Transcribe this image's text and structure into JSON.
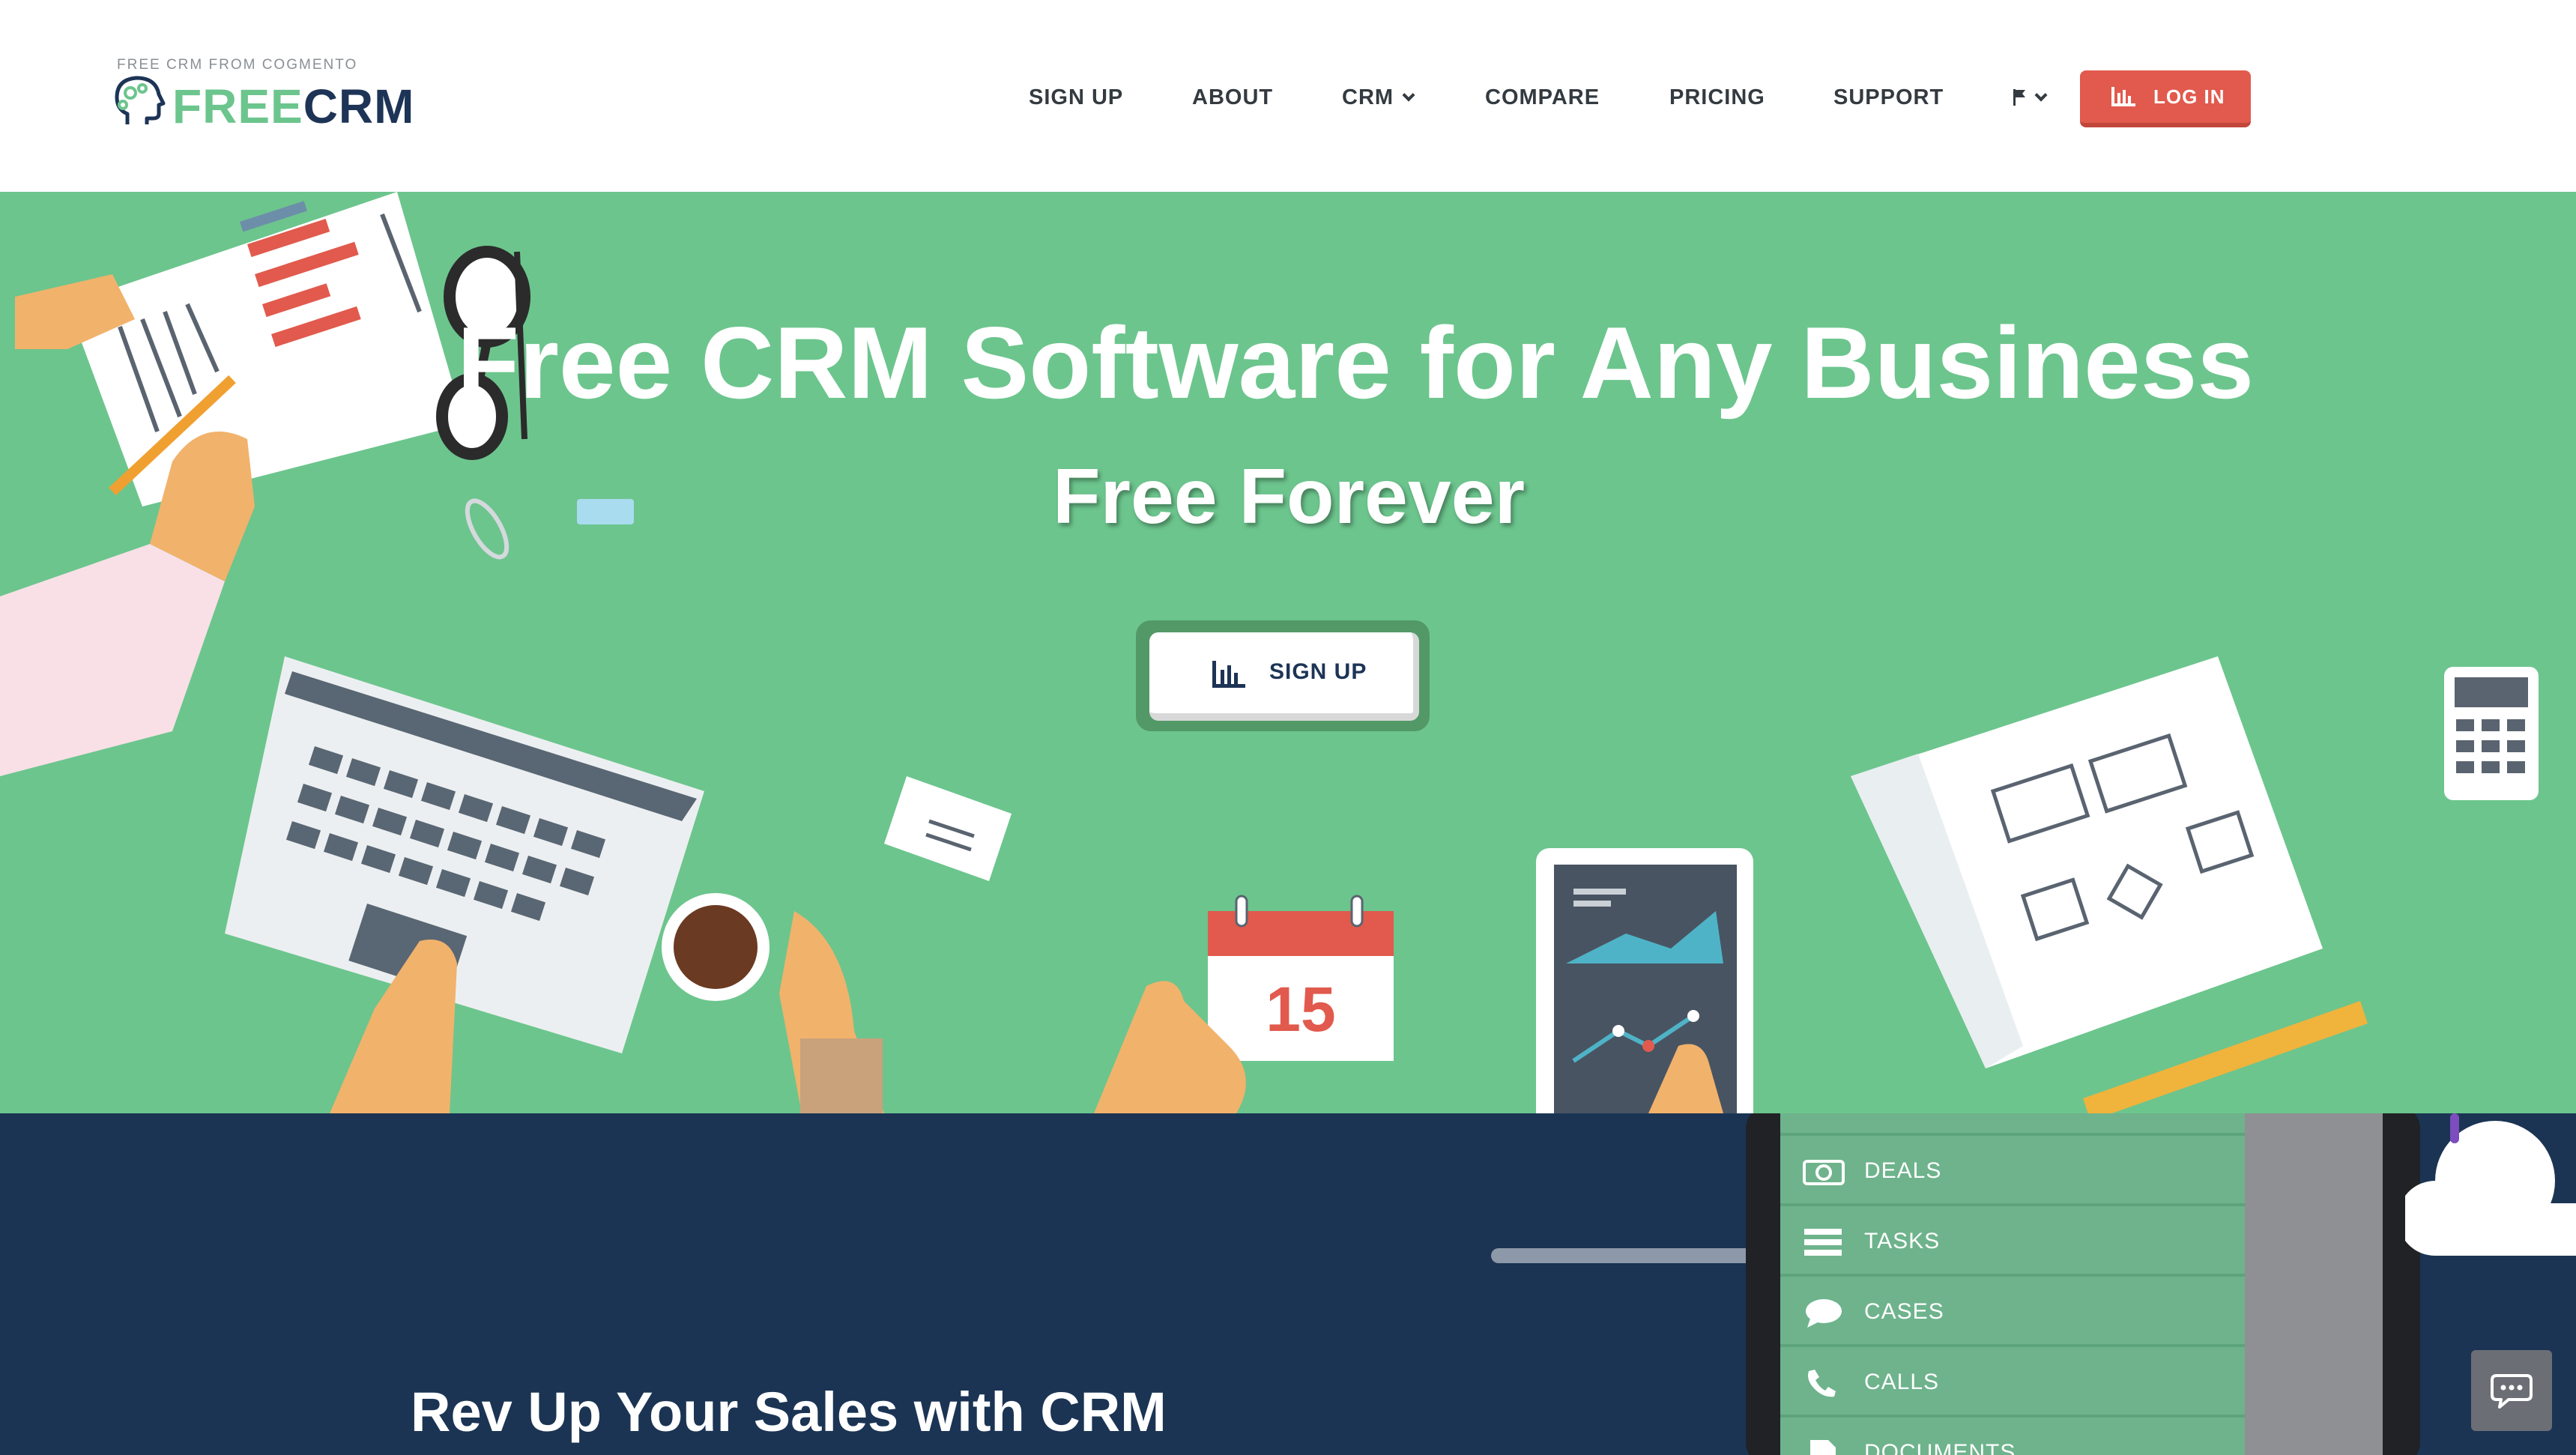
{
  "logo": {
    "tagline": "FREE CRM FROM COGMENTO",
    "word_green": "FREE",
    "word_dark": "CRM"
  },
  "nav": {
    "items": [
      {
        "label": "SIGN UP"
      },
      {
        "label": "ABOUT"
      },
      {
        "label": "CRM",
        "has_dropdown": true
      },
      {
        "label": "COMPARE"
      },
      {
        "label": "PRICING"
      },
      {
        "label": "SUPPORT"
      }
    ],
    "language_icon": "flag-icon",
    "login_label": "LOG IN"
  },
  "hero": {
    "title": "Free CRM Software for Any Business",
    "subtitle": "Free Forever",
    "signup_label": "SIGN UP",
    "calendar_day": "15"
  },
  "section2": {
    "title": "Rev Up Your Sales with CRM",
    "phone_menu": [
      {
        "label": "DEALS",
        "icon": "deals-icon"
      },
      {
        "label": "TASKS",
        "icon": "tasks-icon"
      },
      {
        "label": "CASES",
        "icon": "cases-icon"
      },
      {
        "label": "CALLS",
        "icon": "calls-icon"
      },
      {
        "label": "DOCUMENTS",
        "icon": "documents-icon"
      }
    ]
  },
  "colors": {
    "brand_green": "#6cc58d",
    "brand_navy": "#1d3456",
    "login_red": "#e15a4d"
  }
}
